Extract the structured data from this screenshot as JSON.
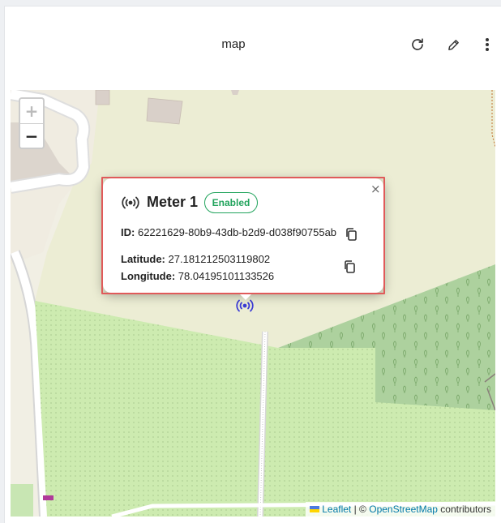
{
  "header": {
    "title": "map",
    "refresh_icon": "refresh-icon",
    "edit_icon": "pencil-icon",
    "more_icon": "more-vertical-icon"
  },
  "map": {
    "zoom_in_label": "+",
    "zoom_out_label": "−",
    "attribution": {
      "leaflet": "Leaflet",
      "separator": "| ©",
      "osm": "OpenStreetMap",
      "suffix": "contributors"
    },
    "colors": {
      "land": "#f1efe4",
      "meadow": "#e6ecd1",
      "forest": "#add19e",
      "grass": "#cdebb0",
      "buildings": "#d9d0c9",
      "road": "#ffffff",
      "accent": "#3b3bd6"
    }
  },
  "popup": {
    "title": "Meter 1",
    "status": "Enabled",
    "status_color": "#22a45d",
    "id_label": "ID:",
    "id_value": "62221629-80b9-43db-b2d9-d038f90755ab",
    "latitude_label": "Latitude:",
    "latitude_value": "27.181212503119802",
    "longitude_label": "Longitude:",
    "longitude_value": "78.04195101133526",
    "close_label": "×",
    "outline_color": "#e05a5a"
  }
}
